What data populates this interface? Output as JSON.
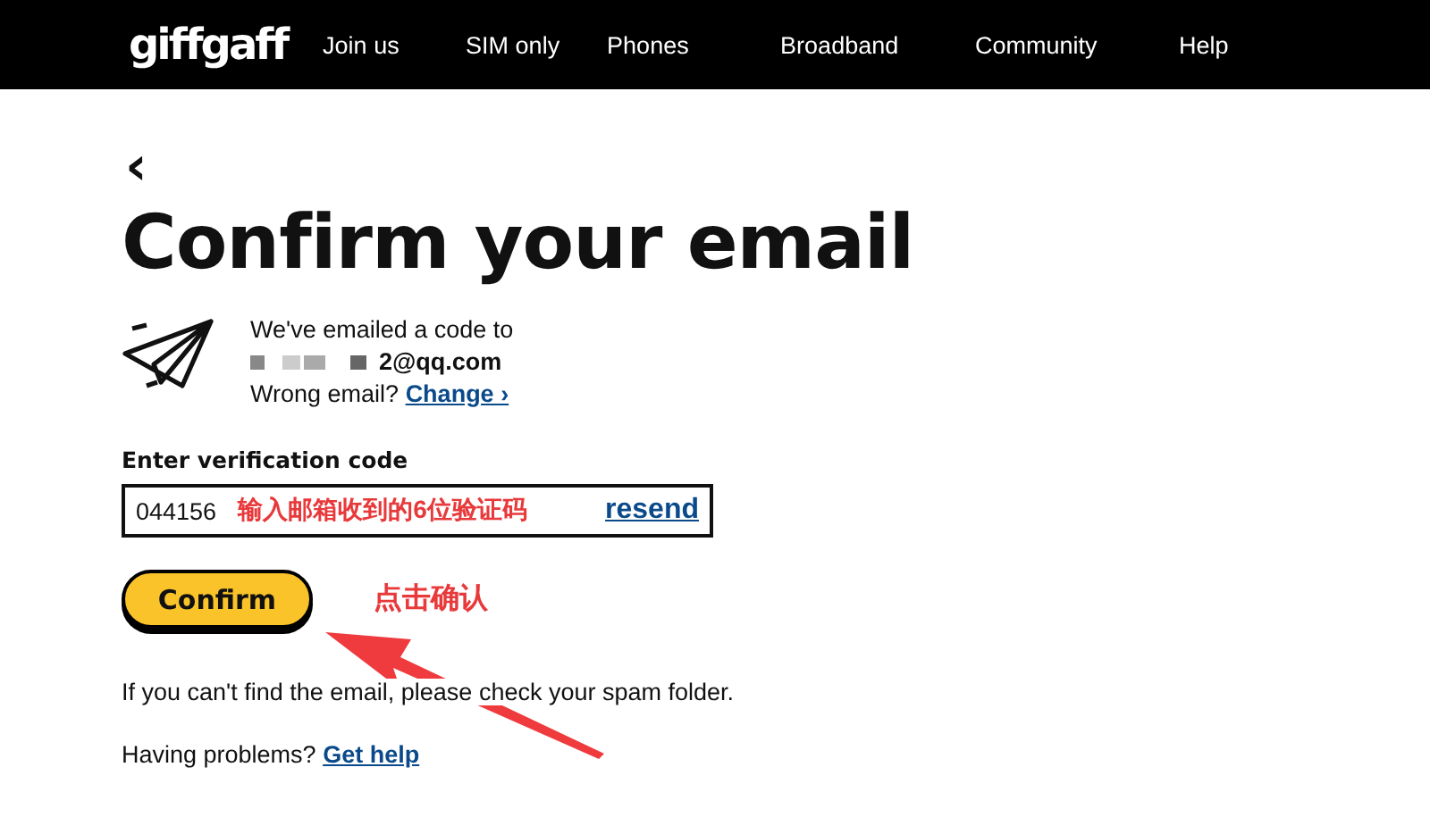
{
  "nav": {
    "logo": "giffgaff",
    "items": [
      "Join us",
      "SIM only",
      "Phones",
      "Broadband",
      "Community",
      "Help"
    ]
  },
  "page": {
    "back": "‹",
    "title": "Confirm your email",
    "sent_text": "We've emailed a code to",
    "email_visible": "2@qq.com",
    "wrong_email": "Wrong email?",
    "change_link": "Change",
    "change_caret": "›",
    "code_label": "Enter verification code",
    "code_field": {
      "value": "044156",
      "resend": "resend"
    },
    "confirm_button": "Confirm",
    "spam_note": "If you can't find the email, please check your spam folder.",
    "problems": "Having problems?",
    "help_link": "Get help"
  },
  "annotations": [
    {
      "kind": "field-note",
      "text": "输入邮箱收到的6位验证码"
    },
    {
      "kind": "button-note",
      "text": "点击确认"
    }
  ]
}
